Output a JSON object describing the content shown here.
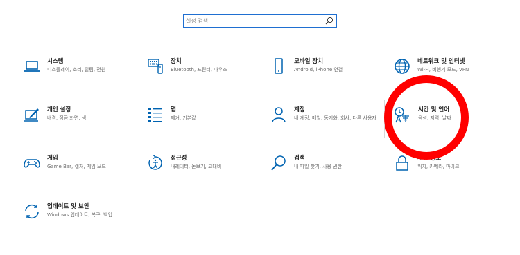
{
  "search": {
    "placeholder": "설정 검색"
  },
  "tiles": [
    {
      "title": "시스템",
      "sub": "디스플레이, 소리, 알림, 전원",
      "icon": "laptop-icon"
    },
    {
      "title": "장치",
      "sub": "Bluetooth, 프린터, 마우스",
      "icon": "keyboard-icon"
    },
    {
      "title": "모바일 장치",
      "sub": "Android, iPhone 연결",
      "icon": "phone-icon"
    },
    {
      "title": "네트워크 및 인터넷",
      "sub": "Wi-Fi, 비행기 모드, VPN",
      "icon": "globe-icon"
    },
    {
      "title": "개인 설정",
      "sub": "배경, 잠금 화면, 색",
      "icon": "personalization-icon"
    },
    {
      "title": "앱",
      "sub": "제거, 기본값",
      "icon": "apps-list-icon"
    },
    {
      "title": "계정",
      "sub": "내 계정, 메일, 동기화, 회사, 다른 사용자",
      "icon": "person-icon"
    },
    {
      "title": "시간 및 언어",
      "sub": "음성, 지역, 날짜",
      "icon": "time-language-icon"
    },
    {
      "title": "게임",
      "sub": "Game Bar, 캡처, 게임 모드",
      "icon": "gamepad-icon"
    },
    {
      "title": "접근성",
      "sub": "내레이터, 돋보기, 고대비",
      "icon": "accessibility-icon"
    },
    {
      "title": "검색",
      "sub": "내 파일 찾기, 사용 권한",
      "icon": "search-icon"
    },
    {
      "title": "개인 정보",
      "sub": "위치, 카메라, 마이크",
      "icon": "lock-icon"
    },
    {
      "title": "업데이트 및 보안",
      "sub": "Windows 업데이트, 복구, 백업",
      "icon": "update-icon"
    }
  ],
  "colors": {
    "accent": "#0063b1",
    "annotation": "#ff0000"
  }
}
